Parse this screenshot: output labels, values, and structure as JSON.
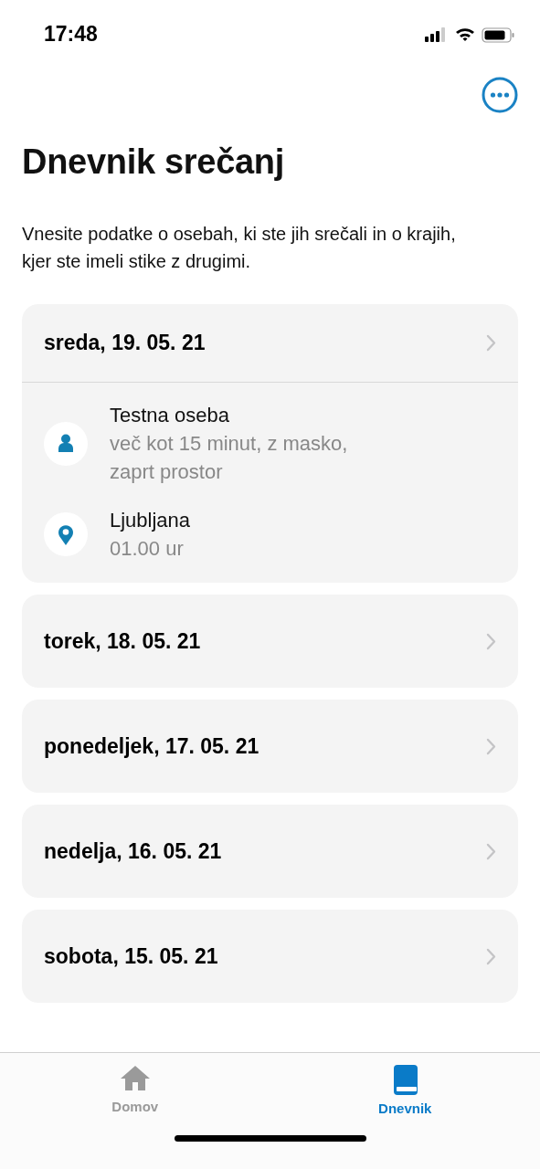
{
  "status_bar": {
    "time": "17:48"
  },
  "title": "Dnevnik srečanj",
  "description": "Vnesite podatke o osebah, ki ste jih srečali in o krajih, kjer ste imeli stike z drugimi.",
  "days": [
    {
      "label": "sreda, 19. 05. 21",
      "expanded": true,
      "entries": [
        {
          "kind": "person",
          "title": "Testna oseba",
          "detail": "več kot 15 minut, z masko, zaprt prostor"
        },
        {
          "kind": "place",
          "title": "Ljubljana",
          "detail": "01.00 ur"
        }
      ]
    },
    {
      "label": "torek, 18. 05. 21",
      "expanded": false
    },
    {
      "label": "ponedeljek, 17. 05. 21",
      "expanded": false
    },
    {
      "label": "nedelja, 16. 05. 21",
      "expanded": false
    },
    {
      "label": "sobota, 15. 05. 21",
      "expanded": false
    }
  ],
  "tabs": [
    {
      "kind": "home",
      "label": "Domov",
      "selected": false
    },
    {
      "kind": "diary",
      "label": "Dnevnik",
      "selected": true
    }
  ]
}
